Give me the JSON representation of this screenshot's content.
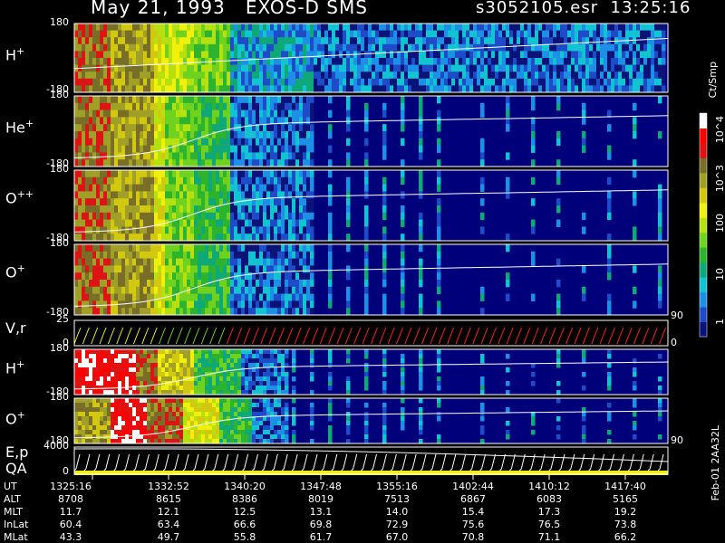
{
  "header": {
    "title_left": "May 21, 1993   EXOS-D SMS",
    "title_right": "s3052105.esr  13:25:16"
  },
  "colorbar": {
    "unit": "Ct/Smp",
    "ticks": [
      "10^4",
      "10^3",
      "100",
      "10",
      "1"
    ]
  },
  "panels": [
    {
      "label": "H",
      "charge": "+",
      "ytop": "180",
      "ybot": "-180"
    },
    {
      "label": "He",
      "charge": "+",
      "ytop": "180",
      "ybot": "-180"
    },
    {
      "label": "O",
      "charge": "++",
      "ytop": "180",
      "ybot": "-180"
    },
    {
      "label": "O",
      "charge": "+",
      "ytop": "180",
      "ybot": "-180"
    },
    {
      "label": "V,r",
      "charge": "",
      "ytop": "25",
      "ybot": "0",
      "rtop": "90",
      "rbot": "0"
    },
    {
      "label": "H",
      "charge": "+",
      "ytop": "180",
      "ybot": "-180"
    },
    {
      "label": "O",
      "charge": "+",
      "ytop": "180",
      "ybot": "-180",
      "rbot": "90"
    },
    {
      "label": "E,p",
      "label2": "QA",
      "charge": "",
      "ytop": "4000",
      "ybot": "0"
    }
  ],
  "footer": {
    "side_label": "Feb-01 2AA32L",
    "rows": [
      {
        "name": "UT",
        "values": [
          "1325:16",
          "1332:52",
          "1340:20",
          "1347:48",
          "1355:16",
          "1402:44",
          "1410:12",
          "1417:40"
        ]
      },
      {
        "name": "ALT",
        "values": [
          "8708",
          "8615",
          "8386",
          "8019",
          "7513",
          "6867",
          "6083",
          "5165"
        ]
      },
      {
        "name": "MLT",
        "values": [
          "11.7",
          "12.1",
          "12.5",
          "13.1",
          "14.0",
          "15.4",
          "17.3",
          "19.2"
        ]
      },
      {
        "name": "InLat",
        "values": [
          "60.4",
          "63.4",
          "66.6",
          "69.8",
          "72.9",
          "75.6",
          "76.5",
          "73.8"
        ]
      },
      {
        "name": "MLat",
        "values": [
          "43.3",
          "49.7",
          "55.8",
          "61.7",
          "67.0",
          "70.8",
          "71.1",
          "66.2"
        ]
      }
    ]
  },
  "chart_data": {
    "type": "heatmap",
    "title": "May 21, 1993   EXOS-D SMS",
    "xlabel": "UT",
    "x_ticks": [
      "1325:16",
      "1332:52",
      "1340:20",
      "1347:48",
      "1355:16",
      "1402:44",
      "1410:12",
      "1417:40"
    ],
    "colorbar": {
      "unit": "Ct/Smp",
      "scale": "log",
      "range": [
        1,
        10000
      ]
    },
    "series": [
      {
        "name": "H+",
        "ylim": [
          -180,
          180
        ]
      },
      {
        "name": "He+",
        "ylim": [
          -180,
          180
        ]
      },
      {
        "name": "O++",
        "ylim": [
          -180,
          180
        ]
      },
      {
        "name": "O+",
        "ylim": [
          -180,
          180
        ]
      },
      {
        "name": "V,r",
        "ylim": [
          0,
          25
        ]
      },
      {
        "name": "H+",
        "ylim": [
          -180,
          180
        ]
      },
      {
        "name": "O+",
        "ylim": [
          -180,
          180
        ]
      },
      {
        "name": "E,p",
        "ylim": [
          0,
          4000
        ]
      }
    ],
    "colors": {
      "bg": "#00007a",
      "palette": [
        "#0a1478",
        "#1e4cc8",
        "#1e8fe6",
        "#12c4d2",
        "#0fa878",
        "#2db32d",
        "#6fd21e",
        "#b4e10f",
        "#f0f00a",
        "#d2c80f",
        "#a0a028",
        "#786e28",
        "#dc1414",
        "#ff0000",
        "#ffffff"
      ]
    }
  }
}
